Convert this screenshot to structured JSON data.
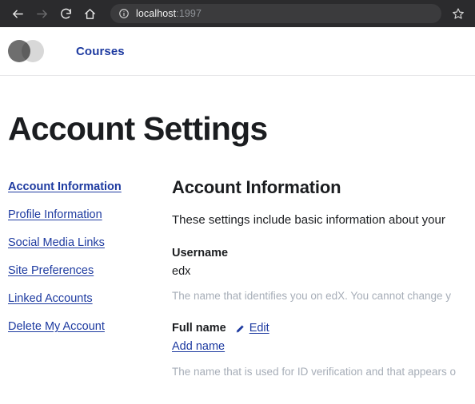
{
  "browser": {
    "back_icon": "arrow-left-icon",
    "forward_icon": "arrow-right-icon",
    "reload_icon": "reload-icon",
    "home_icon": "home-icon",
    "info_icon": "info-circle-icon",
    "bookmark_icon": "star-icon",
    "url_host": "localhost",
    "url_port": ":1997",
    "toolbar_bg": "#2b2b2d",
    "url_pill_bg": "#3b3b3d"
  },
  "site_header": {
    "logo_icon": "edx-logo-circles-icon",
    "logo_color_dark": "#6e6e6e",
    "logo_color_light": "#d8d8d8",
    "nav": [
      {
        "label": "Courses",
        "name": "nav-link-courses"
      }
    ]
  },
  "page": {
    "title": "Account Settings",
    "accent_blue": "#1d3aa0"
  },
  "sidebar": {
    "items": [
      {
        "label": "Account Information",
        "name": "sidebar-item-account-information",
        "active": true
      },
      {
        "label": "Profile Information",
        "name": "sidebar-item-profile-information",
        "active": false
      },
      {
        "label": "Social Media Links",
        "name": "sidebar-item-social-media-links",
        "active": false
      },
      {
        "label": "Site Preferences",
        "name": "sidebar-item-site-preferences",
        "active": false
      },
      {
        "label": "Linked Accounts",
        "name": "sidebar-item-linked-accounts",
        "active": false
      },
      {
        "label": "Delete My Account",
        "name": "sidebar-item-delete-my-account",
        "active": false
      }
    ]
  },
  "main": {
    "heading": "Account Information",
    "description": "These settings include basic information about your",
    "fields": [
      {
        "label": "Username",
        "value": "edx",
        "help": "The name that identifies you on edX. You cannot change y"
      },
      {
        "label": "Full name",
        "edit_label": "Edit",
        "edit_icon": "pencil-icon",
        "link_label": "Add name",
        "help": "The name that is used for ID verification and that appears o"
      }
    ]
  }
}
